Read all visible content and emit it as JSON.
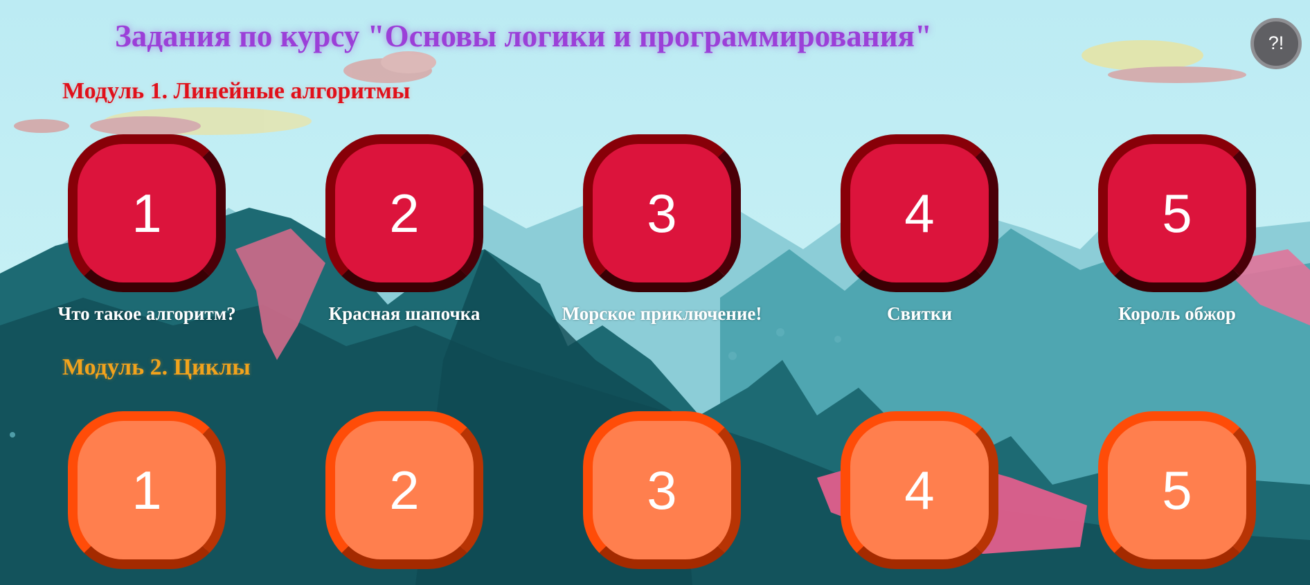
{
  "page": {
    "title": "Задания по курсу \"Основы логики и программирования\"",
    "help_button_label": "?!"
  },
  "modules": [
    {
      "title": "Модуль 1. Линейные алгоритмы",
      "color": "#e0101a",
      "tasks": [
        {
          "number": "1",
          "label": "Что такое алгоритм?"
        },
        {
          "number": "2",
          "label": "Красная шапочка"
        },
        {
          "number": "3",
          "label": "Морское приключение!"
        },
        {
          "number": "4",
          "label": "Свитки"
        },
        {
          "number": "5",
          "label": "Король обжор"
        }
      ]
    },
    {
      "title": "Модуль 2. Циклы",
      "color": "#f2a31c",
      "tasks": [
        {
          "number": "1"
        },
        {
          "number": "2"
        },
        {
          "number": "3"
        },
        {
          "number": "4"
        },
        {
          "number": "5"
        }
      ]
    }
  ],
  "colors": {
    "title": "#9b3fd8",
    "module1_tile": "#dc143c",
    "module1_border": "#880008",
    "module2_tile": "#ff7f4e",
    "module2_border": "#ff4c08",
    "sky": "#bfeef4"
  }
}
